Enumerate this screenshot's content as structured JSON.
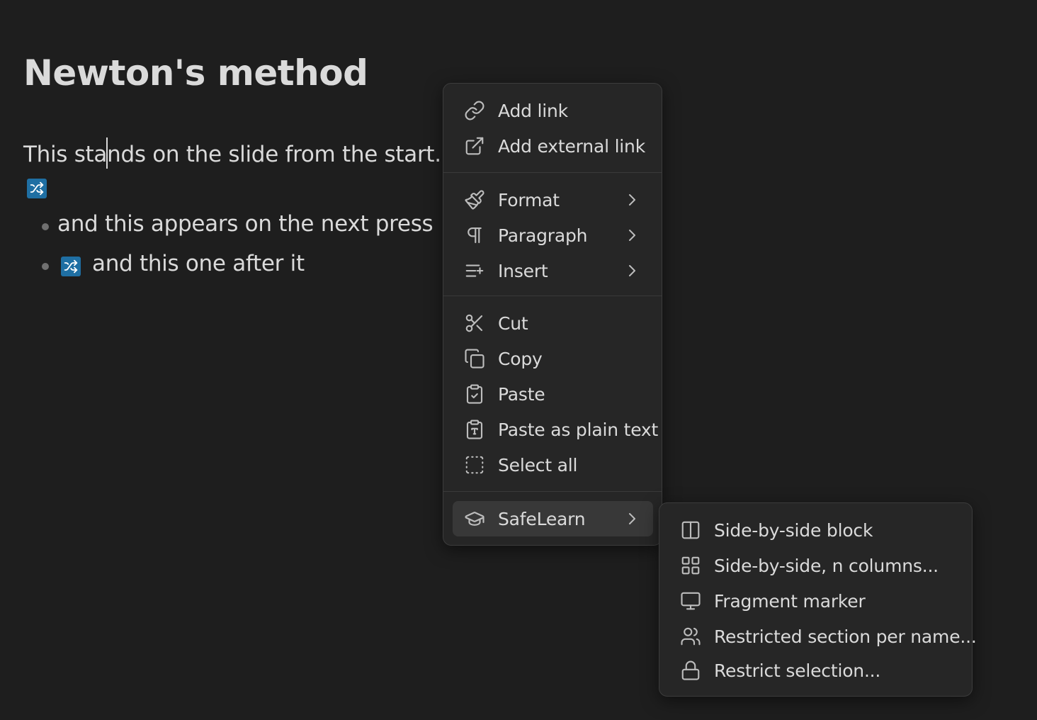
{
  "document": {
    "title": "Newton's method",
    "paragraph_before_caret": "This sta",
    "paragraph_after_caret": "nds on the slide from the start.",
    "bullets": [
      {
        "text": "and this appears on the next press"
      },
      {
        "text": "and this one after it"
      }
    ]
  },
  "context_menu": {
    "groups": [
      [
        {
          "label": "Add link",
          "icon": "link-icon"
        },
        {
          "label": "Add external link",
          "icon": "external-link-icon"
        }
      ],
      [
        {
          "label": "Format",
          "icon": "paintbrush-icon",
          "submenu": true
        },
        {
          "label": "Paragraph",
          "icon": "pilcrow-icon",
          "submenu": true
        },
        {
          "label": "Insert",
          "icon": "list-plus-icon",
          "submenu": true
        }
      ],
      [
        {
          "label": "Cut",
          "icon": "scissors-icon"
        },
        {
          "label": "Copy",
          "icon": "copy-icon"
        },
        {
          "label": "Paste",
          "icon": "clipboard-check-icon"
        },
        {
          "label": "Paste as plain text",
          "icon": "clipboard-type-icon"
        },
        {
          "label": "Select all",
          "icon": "select-dashed-icon"
        }
      ],
      [
        {
          "label": "SafeLearn",
          "icon": "graduation-cap-icon",
          "submenu": true,
          "active": true
        }
      ]
    ]
  },
  "submenu": {
    "items": [
      {
        "label": "Side-by-side block",
        "icon": "columns-icon"
      },
      {
        "label": "Side-by-side, n columns...",
        "icon": "grid-icon"
      },
      {
        "label": "Fragment marker",
        "icon": "monitor-icon"
      },
      {
        "label": "Restricted section per name...",
        "icon": "users-icon"
      },
      {
        "label": "Restrict selection...",
        "icon": "lock-icon"
      }
    ]
  },
  "colors": {
    "background": "#1e1e1e",
    "menu_background": "#262626",
    "active_item": "#383838",
    "fragment_marker": "#1f6fa3",
    "text": "#dadada"
  }
}
